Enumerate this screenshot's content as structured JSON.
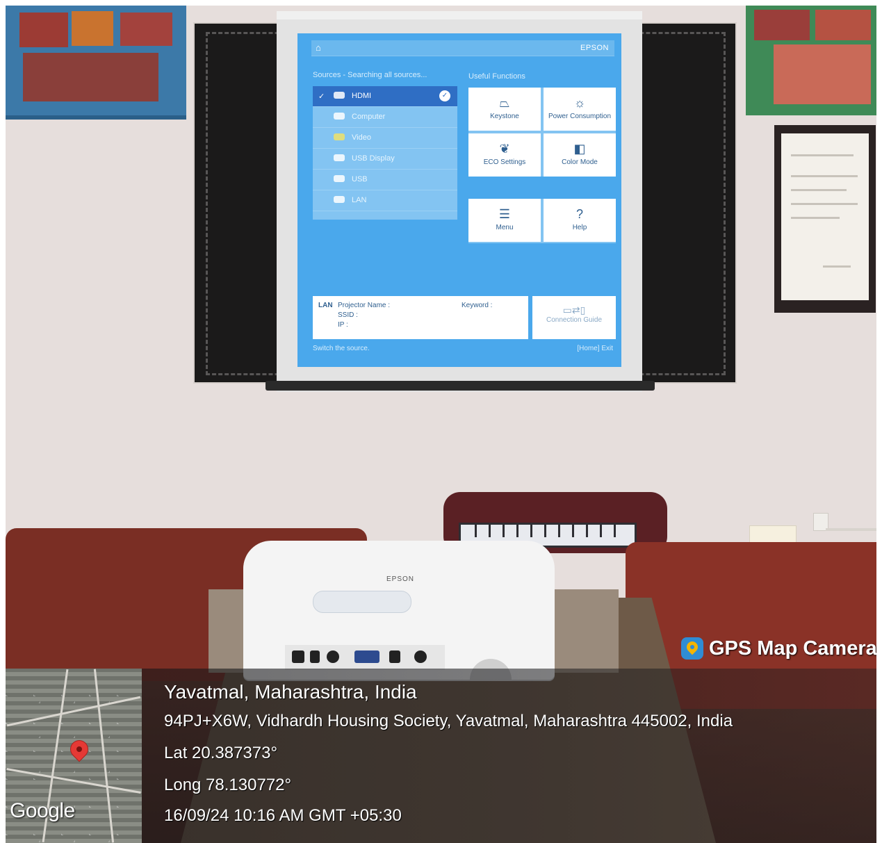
{
  "screen": {
    "brand": "EPSON",
    "sources_title": "Sources - Searching all sources...",
    "useful_title": "Useful Functions",
    "sources": [
      {
        "label": "HDMI",
        "active": true
      },
      {
        "label": "Computer",
        "active": false
      },
      {
        "label": "Video",
        "active": false
      },
      {
        "label": "USB Display",
        "active": false
      },
      {
        "label": "USB",
        "active": false
      },
      {
        "label": "LAN",
        "active": false
      }
    ],
    "features": [
      {
        "label": "Keystone",
        "icon": "keystone-icon"
      },
      {
        "label": "Power Consumption",
        "icon": "lightbulb-icon"
      },
      {
        "label": "ECO Settings",
        "icon": "leaf-icon"
      },
      {
        "label": "Color Mode",
        "icon": "color-mode-icon"
      },
      {
        "label": "Menu",
        "icon": "menu-icon"
      },
      {
        "label": "Help",
        "icon": "help-icon"
      }
    ],
    "info": {
      "lan_label": "LAN",
      "projector_name": "Projector Name :",
      "ssid": "SSID :",
      "ip": "IP :",
      "keyword": "Keyword :"
    },
    "connection_guide": "Connection Guide",
    "footer_left": "Switch the source.",
    "footer_right": "[Home] Exit"
  },
  "projector": {
    "brand": "EPSON"
  },
  "gps": {
    "app_name": "GPS Map Camera",
    "map_logo": "Google",
    "city": "Yavatmal, Maharashtra, India",
    "address": "94PJ+X6W, Vidhardh Housing Society, Yavatmal, Maharashtra 445002, India",
    "lat": "Lat 20.387373°",
    "long": "Long 78.130772°",
    "timestamp": "16/09/24 10:16 AM GMT +05:30"
  }
}
